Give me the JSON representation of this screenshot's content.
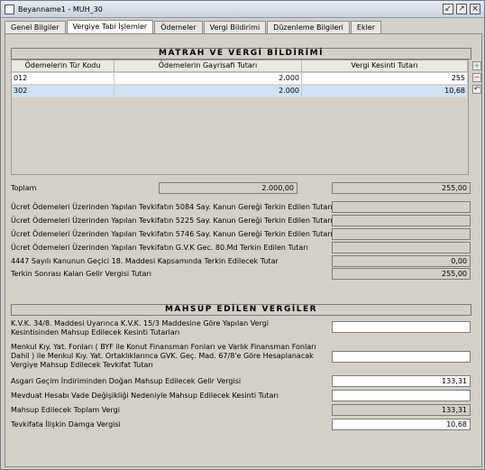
{
  "window": {
    "title": "Beyanname1 - MUH_30",
    "controls": {
      "restore": "↙",
      "maximize": "↗",
      "close": "×"
    }
  },
  "tabs": [
    {
      "label": "Genel Bilgiler",
      "active": false
    },
    {
      "label": "Vergiye Tabi İşlemler",
      "active": true
    },
    {
      "label": "Ödemeler",
      "active": false
    },
    {
      "label": "Vergi Bildirimi",
      "active": false
    },
    {
      "label": "Düzenleme Bilgileri",
      "active": false
    },
    {
      "label": "Ekler",
      "active": false
    }
  ],
  "matrah": {
    "title": "MATRAH VE VERGİ BİLDİRİMİ",
    "columns": [
      "Ödemelerin Tür Kodu",
      "Ödemelerin Gayrisafi Tutarı",
      "Vergi Kesinti Tutarı"
    ],
    "rows": [
      {
        "code": "012",
        "gross": "2.000",
        "tax": "255"
      },
      {
        "code": "302",
        "gross": "2.000",
        "tax": "10,68"
      }
    ],
    "total_label": "Toplam",
    "total_gross": "2.000,00",
    "total_tax": "255,00",
    "lines": [
      {
        "label": "Ücret Ödemeleri Üzerinden Yapılan Tevkifatın 5084 Say. Kanun Gereği Terkin Edilen Tutarı",
        "value": ""
      },
      {
        "label": "Ücret Ödemeleri Üzerinden Yapılan Tevkifatın 5225 Say. Kanun Gereği Terkin Edilen Tutarı",
        "value": ""
      },
      {
        "label": "Ücret Ödemeleri Üzerinden Yapılan Tevkifatın 5746 Say. Kanun Gereği Terkin Edilen Tutarı",
        "value": ""
      },
      {
        "label": "Ücret Ödemeleri Üzerinden Yapılan Tevkifatın G.V.K Gec. 80.Md Terkin Edilen Tutarı",
        "value": ""
      },
      {
        "label": "4447 Sayılı Kanunun Geçici 18. Maddesi Kapsamında Terkin Edilecek Tutar",
        "value": "0,00"
      },
      {
        "label": "Terkin Sonrası Kalan Gelir Vergisi Tutarı",
        "value": "255,00"
      }
    ]
  },
  "mahsup": {
    "title": "MAHSUP EDİLEN VERGİLER",
    "lines": [
      {
        "label": "K.V.K. 34/8. Maddesi Uyarınca K.V.K. 15/3 Maddesine Göre Yapılan Vergi Kesintisinden Mahsup Edilecek Kesinti Tutarları",
        "value": ""
      },
      {
        "label": "Menkul Kıy. Yat. Fonları ( BYF ile Konut Finansman Fonları ve Varlık Finansman Fonları Dahil ) ile Menkul Kıy. Yat. Ortaklıklarınca GVK. Geç. Mad. 67/8'e Göre Hesaplanacak Vergiye Mahsup Edilecek Tevkifat Tutarı",
        "value": ""
      },
      {
        "label": "Asgari Geçim İndiriminden Doğan Mahsup Edilecek Gelir Vergisi",
        "value": "133,31"
      },
      {
        "label": "Mevduat Hesabı Vade Değişikliği Nedeniyle Mahsup Edilecek Kesinti Tutarı",
        "value": ""
      },
      {
        "label": "Mahsup Edilecek Toplam Vergi",
        "value": "133,31"
      },
      {
        "label": "Tevkifata İlişkin Damga Vergisi",
        "value": "10,68"
      }
    ]
  },
  "side_tools": {
    "add": "+",
    "remove": "−",
    "undo": "↶"
  }
}
